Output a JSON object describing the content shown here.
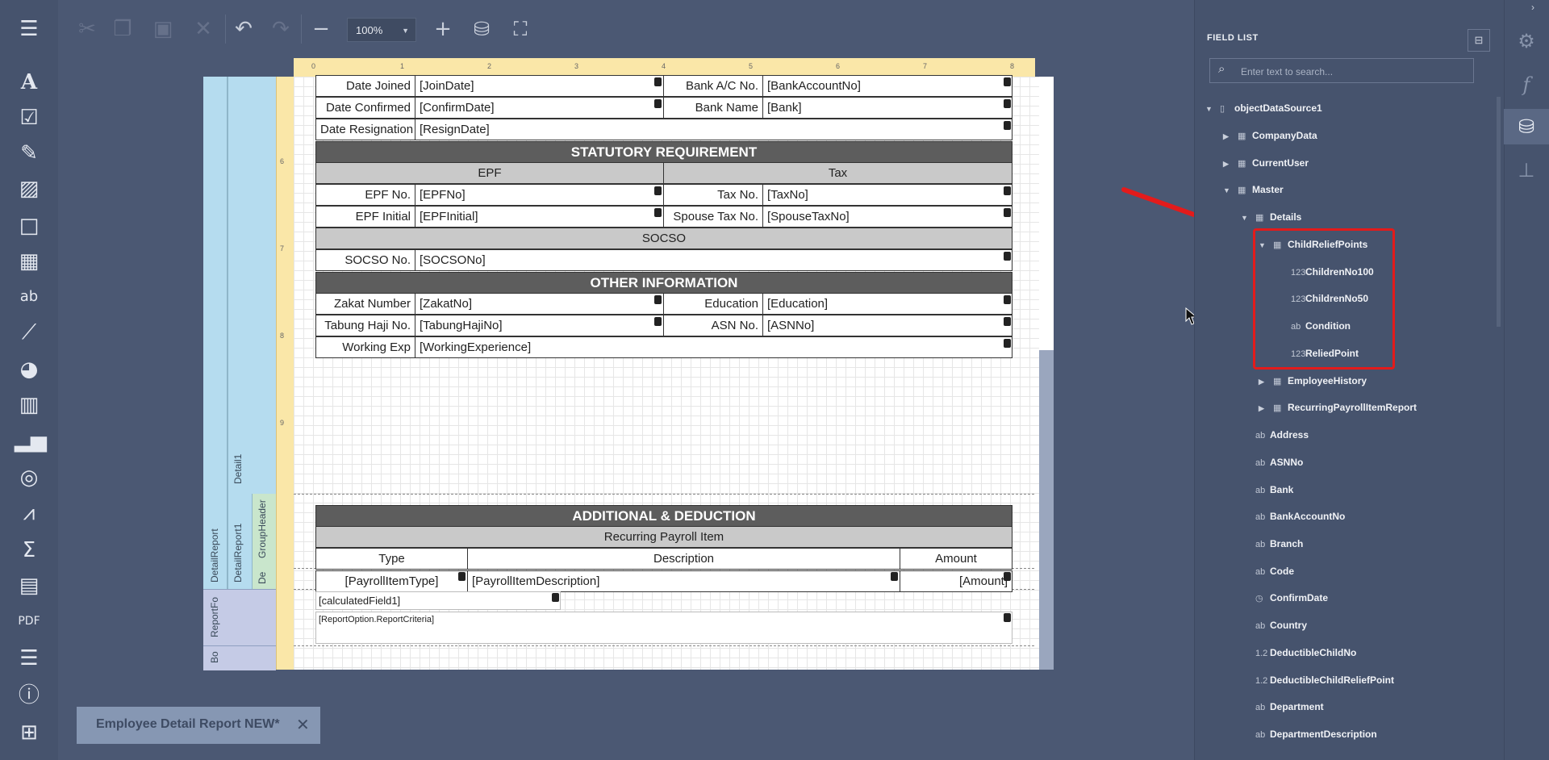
{
  "toolbar": {
    "zoom_value": "100%",
    "icons": [
      "cut-icon",
      "copy-icon",
      "paste-icon",
      "delete-icon",
      "undo-icon",
      "redo-icon",
      "zoom-out-icon",
      "zoom-in-icon",
      "validate-icon",
      "fullscreen-icon"
    ]
  },
  "toolbox": {
    "icons": [
      "menu-icon",
      "label-icon",
      "checkbox-icon",
      "richtext-icon",
      "picture-icon",
      "panel-icon",
      "table-icon",
      "character-comb-icon",
      "line-icon",
      "shape-icon",
      "barcode-icon",
      "chart-icon",
      "gauge-icon",
      "sparkline-icon",
      "summary-icon",
      "subreport-icon",
      "pdf-icon",
      "table-of-contents-icon",
      "page-info-icon",
      "cross-tab-icon"
    ]
  },
  "bands": {
    "detail1": "Detail1",
    "detail_report": "DetailReport",
    "detail_report1": "DetailReport1",
    "group_header": "GroupHeader",
    "de": "De",
    "report_footer": "ReportFo",
    "bottom": "Bo"
  },
  "ruler": {
    "h_ticks": [
      "0",
      "1",
      "2",
      "3",
      "4",
      "5",
      "6",
      "7",
      "8"
    ],
    "v_ticks": [
      "6",
      "7",
      "8",
      "9"
    ]
  },
  "report": {
    "rows1": [
      {
        "l_label": "Date Joined",
        "l_field": "[JoinDate]",
        "r_label": "Bank A/C No.",
        "r_field": "[BankAccountNo]"
      },
      {
        "l_label": "Date Confirmed",
        "l_field": "[ConfirmDate]",
        "r_label": "Bank Name",
        "r_field": "[Bank]"
      }
    ],
    "resign_label": "Date Resignation",
    "resign_field": "[ResignDate]",
    "statutory_header": "STATUTORY REQUIREMENT",
    "epf_header": "EPF",
    "tax_header": "Tax",
    "rows2": [
      {
        "l_label": "EPF No.",
        "l_field": "[EPFNo]",
        "r_label": "Tax No.",
        "r_field": "[TaxNo]"
      },
      {
        "l_label": "EPF Initial",
        "l_field": "[EPFInitial]",
        "r_label": "Spouse Tax No.",
        "r_field": "[SpouseTaxNo]"
      }
    ],
    "socso_header": "SOCSO",
    "socso_label": "SOCSO No.",
    "socso_field": "[SOCSONo]",
    "other_header": "OTHER INFORMATION",
    "rows3": [
      {
        "l_label": "Zakat Number",
        "l_field": "[ZakatNo]",
        "r_label": "Education",
        "r_field": "[Education]"
      },
      {
        "l_label": "Tabung Haji No.",
        "l_field": "[TabungHajiNo]",
        "r_label": "ASN No.",
        "r_field": "[ASNNo]"
      }
    ],
    "workexp_label": "Working Exp",
    "workexp_field": "[WorkingExperience]",
    "additional_header": "ADDITIONAL & DEDUCTION",
    "recurring_header": "Recurring Payroll Item",
    "col_type": "Type",
    "col_description": "Description",
    "col_amount": "Amount",
    "item_type": "[PayrollItemType]",
    "item_description": "[PayrollItemDescription]",
    "item_amount": "[Amount]",
    "calc_field": "[calculatedField1]",
    "criteria_field": "[ReportOption.ReportCriteria]"
  },
  "field_list": {
    "title": "FIELD LIST",
    "search_placeholder": "Enter text to search...",
    "nodes": [
      {
        "label": "objectDataSource1",
        "exp": "▼",
        "ico": "▯"
      },
      {
        "label": "CompanyData",
        "exp": "▶",
        "ico": "▦"
      },
      {
        "label": "CurrentUser",
        "exp": "▶",
        "ico": "▦"
      },
      {
        "label": "Master",
        "exp": "▼",
        "ico": "▦"
      },
      {
        "label": "Details",
        "exp": "▼",
        "ico": "▦"
      },
      {
        "label": "ChildReliefPoints",
        "exp": "▼",
        "ico": "▦"
      },
      {
        "label": "ChildrenNo100",
        "exp": "",
        "ico": "123"
      },
      {
        "label": "ChildrenNo50",
        "exp": "",
        "ico": "123"
      },
      {
        "label": "Condition",
        "exp": "",
        "ico": "ab"
      },
      {
        "label": "ReliedPoint",
        "exp": "",
        "ico": "123"
      },
      {
        "label": "EmployeeHistory",
        "exp": "▶",
        "ico": "▦"
      },
      {
        "label": "RecurringPayrollItemReport",
        "exp": "▶",
        "ico": "▦"
      },
      {
        "label": "Address",
        "exp": "",
        "ico": "ab"
      },
      {
        "label": "ASNNo",
        "exp": "",
        "ico": "ab"
      },
      {
        "label": "Bank",
        "exp": "",
        "ico": "ab"
      },
      {
        "label": "BankAccountNo",
        "exp": "",
        "ico": "ab"
      },
      {
        "label": "Branch",
        "exp": "",
        "ico": "ab"
      },
      {
        "label": "Code",
        "exp": "",
        "ico": "ab"
      },
      {
        "label": "ConfirmDate",
        "exp": "",
        "ico": "◷"
      },
      {
        "label": "Country",
        "exp": "",
        "ico": "ab"
      },
      {
        "label": "DeductibleChildNo",
        "exp": "",
        "ico": "1.2"
      },
      {
        "label": "DeductibleChildReliefPoint",
        "exp": "",
        "ico": "1.2"
      },
      {
        "label": "Department",
        "exp": "",
        "ico": "ab"
      },
      {
        "label": "DepartmentDescription",
        "exp": "",
        "ico": "ab"
      }
    ]
  },
  "document_tab": {
    "title": "Employee Detail Report NEW*"
  },
  "colors": {
    "highlight": "#e31b1b",
    "background": "#4b5873",
    "panel": "#46536d"
  }
}
